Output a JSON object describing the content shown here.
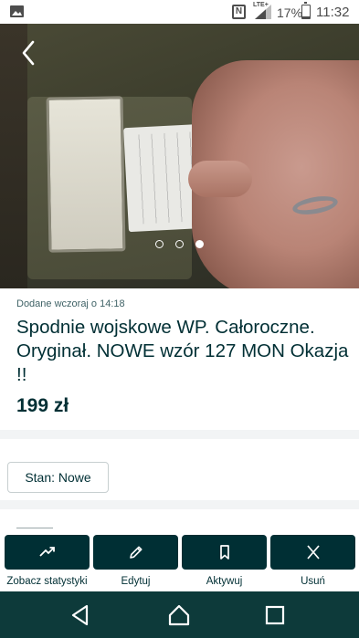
{
  "status_bar": {
    "battery_percent": "17%",
    "network": "LTE+",
    "time": "11:32",
    "battery_level": 0.17,
    "icons": [
      "image-notification-icon",
      "nfc-icon",
      "signal-icon",
      "battery-icon"
    ]
  },
  "gallery": {
    "image_count": 3,
    "active_index": 2,
    "back_icon": "chevron-left-icon"
  },
  "listing": {
    "posted": "Dodane wczoraj o 14:18",
    "title": "Spodnie wojskowe WP. Całoroczne. Oryginał. NOWE wzór 127 MON Okazja !!",
    "price": "199 zł",
    "condition_chip": "Stan: Nowe"
  },
  "actions": [
    {
      "label": "Zobacz statystyki",
      "icon": "trending-up-icon"
    },
    {
      "label": "Edytuj",
      "icon": "pencil-icon"
    },
    {
      "label": "Aktywuj",
      "icon": "bookmark-icon"
    },
    {
      "label": "Usuń",
      "icon": "close-icon"
    }
  ],
  "nav_bar": {
    "icons": [
      "back-triangle-icon",
      "home-icon",
      "recents-icon"
    ]
  },
  "colors": {
    "primary_dark": "#002f34",
    "nav_bar": "#0d3a3a",
    "divider": "#f2f4f5"
  }
}
